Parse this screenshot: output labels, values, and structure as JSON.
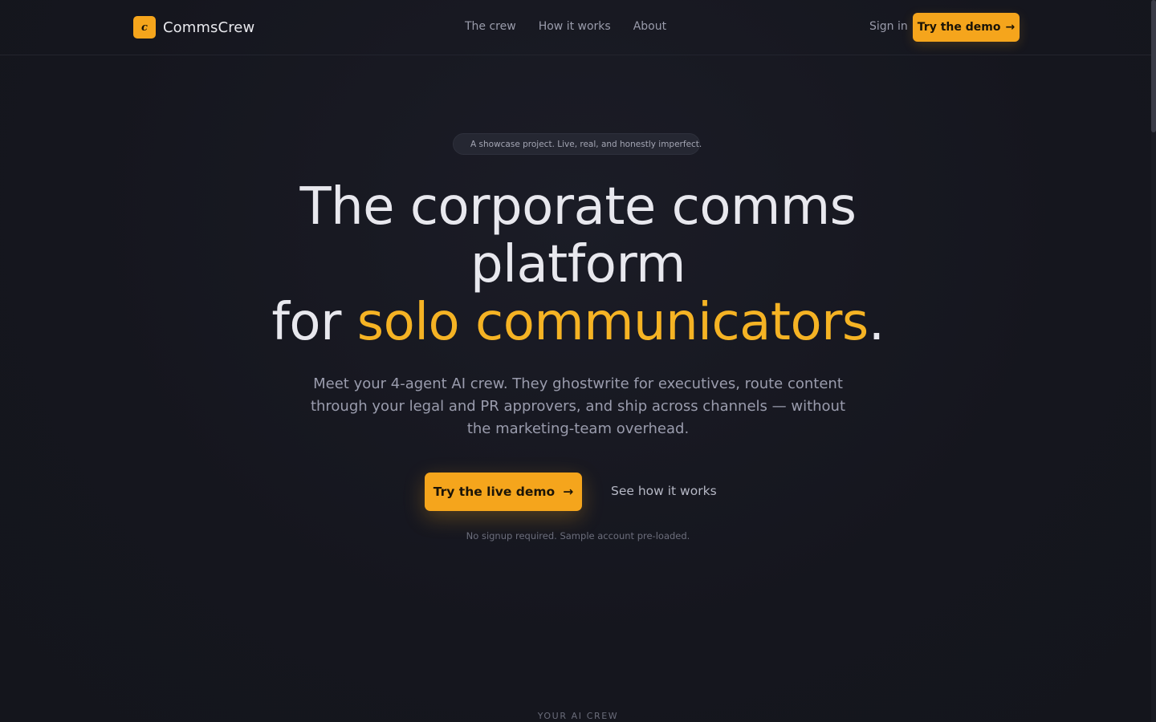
{
  "header": {
    "brand_letter": "c",
    "brand_name": "CommsCrew",
    "nav": [
      "The crew",
      "How it works",
      "About"
    ],
    "sign_in": "Sign in",
    "cta_label": "Try the demo",
    "cta_icon": "arrow-right-icon"
  },
  "hero": {
    "badge": "A showcase project. Live, real, and honestly imperfect.",
    "headline_line1": "The corporate comms",
    "headline_line2": "platform",
    "headline_line3_prefix": "for ",
    "headline_line3_accent": "solo communicators",
    "headline_line3_suffix": ".",
    "subheadline": "Meet your 4-agent AI crew. They ghostwrite for executives, route content through your legal and PR approvers, and ship across channels — without the marketing-team overhead.",
    "primary_cta": "Try the live demo",
    "secondary_cta": "See how it works",
    "note": "No signup required. Sample account pre-loaded."
  },
  "next_section": {
    "label": "YOUR AI CREW"
  },
  "colors": {
    "background": "#15161e",
    "accent": "#f5a51c",
    "accent_text": "#f5b324",
    "status_dot": "#5fb89a"
  }
}
